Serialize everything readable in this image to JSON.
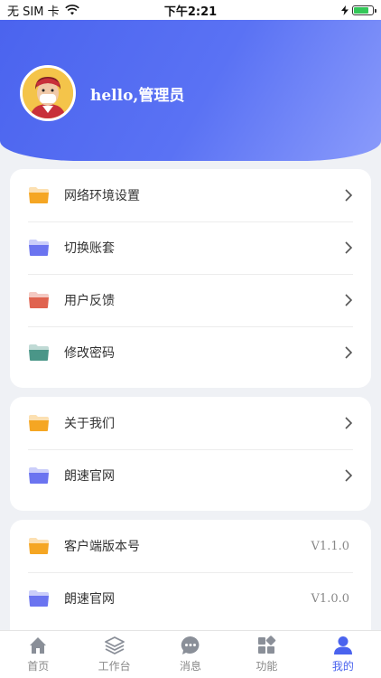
{
  "status_bar": {
    "carrier": "无 SIM 卡",
    "time": "下午2:21",
    "battery_level": 0.8
  },
  "profile": {
    "greeting": "hello,管理员"
  },
  "menu_group_1": [
    {
      "label": "网络环境设置",
      "folder_color": "#f5a623"
    },
    {
      "label": "切换账套",
      "folder_color": "#6b74f0"
    },
    {
      "label": "用户反馈",
      "folder_color": "#e0634f"
    },
    {
      "label": "修改密码",
      "folder_color": "#4a9688"
    }
  ],
  "menu_group_2": [
    {
      "label": "关于我们",
      "folder_color": "#f5a623"
    },
    {
      "label": "朗速官网",
      "folder_color": "#6b74f0"
    }
  ],
  "menu_group_3": [
    {
      "label": "客户端版本号",
      "value": "V1.1.0",
      "folder_color": "#f5a623"
    },
    {
      "label": "朗速官网",
      "value": "V1.0.0",
      "folder_color": "#6b74f0"
    }
  ],
  "tabbar": {
    "tabs": [
      {
        "label": "首页",
        "icon": "home-icon"
      },
      {
        "label": "工作台",
        "icon": "layers-icon"
      },
      {
        "label": "消息",
        "icon": "chat-icon"
      },
      {
        "label": "功能",
        "icon": "grid-icon"
      },
      {
        "label": "我的",
        "icon": "user-icon",
        "active": true
      }
    ]
  },
  "colors": {
    "accent": "#4a63ee",
    "header_gradient_end": "#8a9bfb"
  }
}
